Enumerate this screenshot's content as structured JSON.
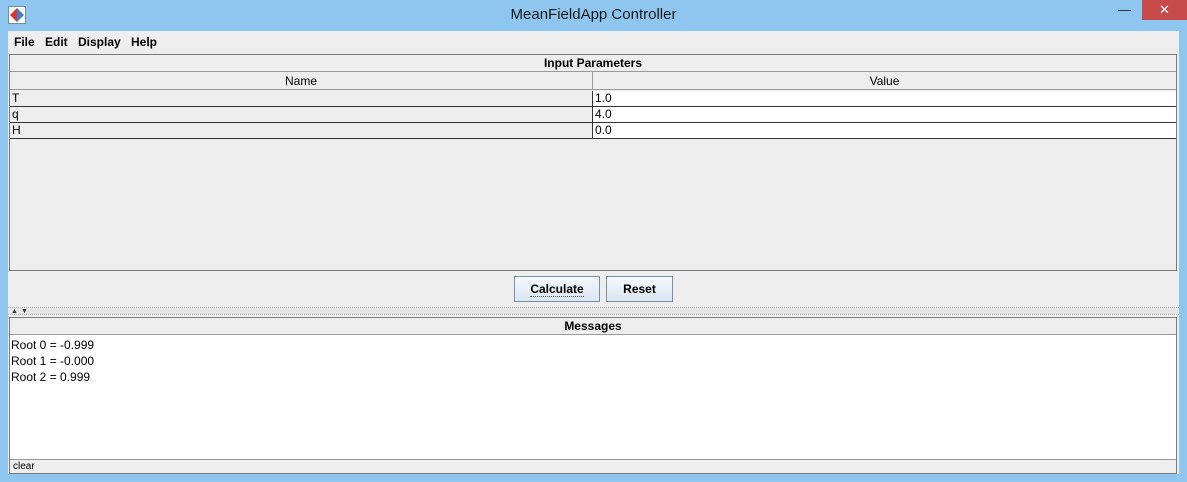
{
  "window": {
    "title": "MeanFieldApp Controller",
    "min_glyph": "—",
    "max_glyph": "☐",
    "close_glyph": "✕"
  },
  "menu": [
    "File",
    "Edit",
    "Display",
    "Help"
  ],
  "input_panel": {
    "title": "Input Parameters",
    "columns": [
      "Name",
      "Value"
    ],
    "rows": [
      {
        "name": "T",
        "value": "1.0"
      },
      {
        "name": "q",
        "value": "4.0"
      },
      {
        "name": "H",
        "value": "0.0"
      }
    ]
  },
  "buttons": {
    "calculate": "Calculate",
    "reset": "Reset"
  },
  "messages_panel": {
    "title": "Messages",
    "lines": [
      "Root 0 = -0.999",
      "Root 1 = -0.000",
      "Root 2 = 0.999"
    ],
    "clear_label": "clear"
  }
}
